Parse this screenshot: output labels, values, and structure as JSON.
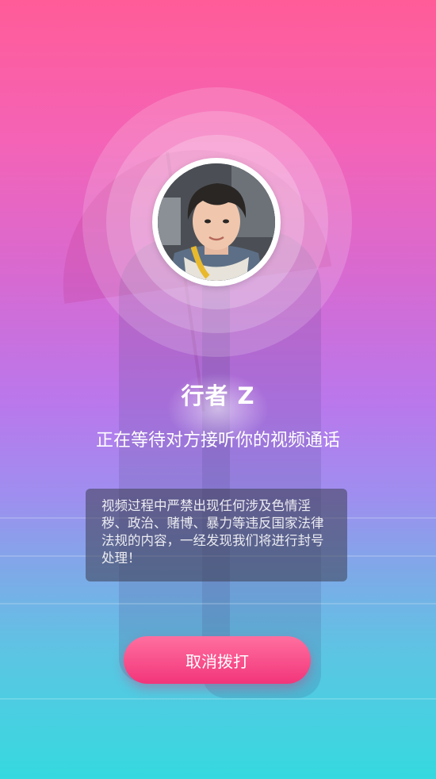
{
  "call": {
    "caller_name": "行者 Z",
    "status": "正在等待对方接听你的视频通话",
    "notice": "视频过程中严禁出现任何涉及色情淫秽、政治、赌博、暴力等违反国家法律法规的内容，一经发现我们将进行封号处理！",
    "cancel_label": "取消拨打"
  },
  "theme": {
    "gradient_top": "#ff5c98",
    "gradient_mid": "#b978ec",
    "gradient_bottom": "#35d9df",
    "button_color": "#f2357a"
  }
}
